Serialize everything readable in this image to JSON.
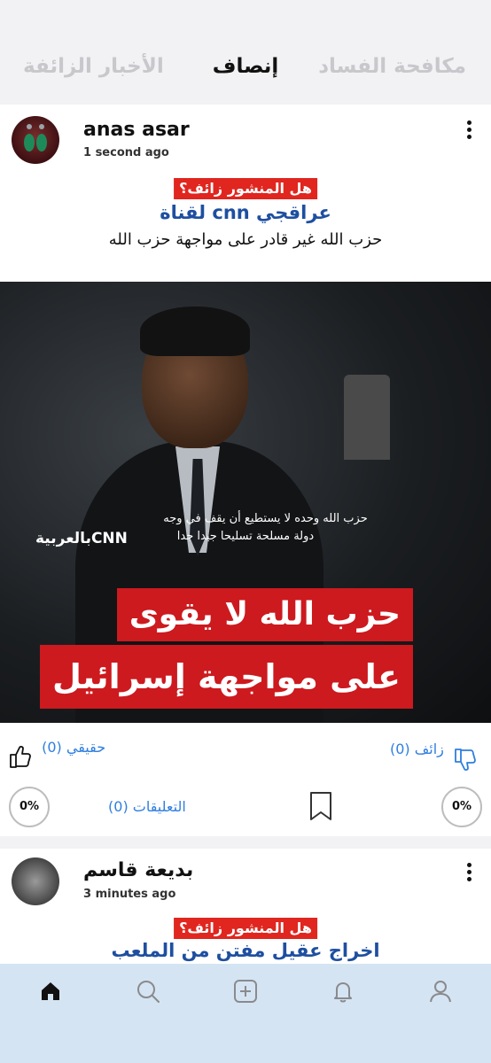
{
  "tabs": [
    "مكافحة الفساد",
    "إنصاف",
    "الأخبار الزائفة"
  ],
  "posts": [
    {
      "user": "anas asar",
      "time": "1 second ago",
      "fake_question": "هل المنشور زائف؟",
      "title": "لقناة cnn عراقجي",
      "body": "حزب الله غير قادر على مواجهة حزب الله",
      "media": {
        "subtitle_line1": "حزب الله وحده لا يستطيع أن يقف في وجه",
        "subtitle_line2": "دولة مسلحة تسليحا جيدا جدا",
        "logo_text": "بالعربيةCNN",
        "headline_line1": "حزب الله لا يقوى",
        "headline_line2": "على مواجهة إسرائيل"
      },
      "fake_label": "زائف (0)",
      "real_label": "حقيقي (0)",
      "comments_label": "التعليقات (0)",
      "fake_percent": "0%",
      "real_percent": "0%"
    },
    {
      "user": "بديعة قاسم",
      "time": "3 minutes ago",
      "fake_question": "هل المنشور زائف؟",
      "title": "اخراج عقيل مفتن من الملعب"
    }
  ],
  "nav": [
    "home-icon",
    "search-icon",
    "add-icon",
    "bell-icon",
    "profile-icon"
  ],
  "colors": {
    "accent_blue": "#2f7ee0",
    "title_blue": "#1e4fa0",
    "fake_red": "#e0261f",
    "navbar_bg": "#d4e4f2"
  }
}
